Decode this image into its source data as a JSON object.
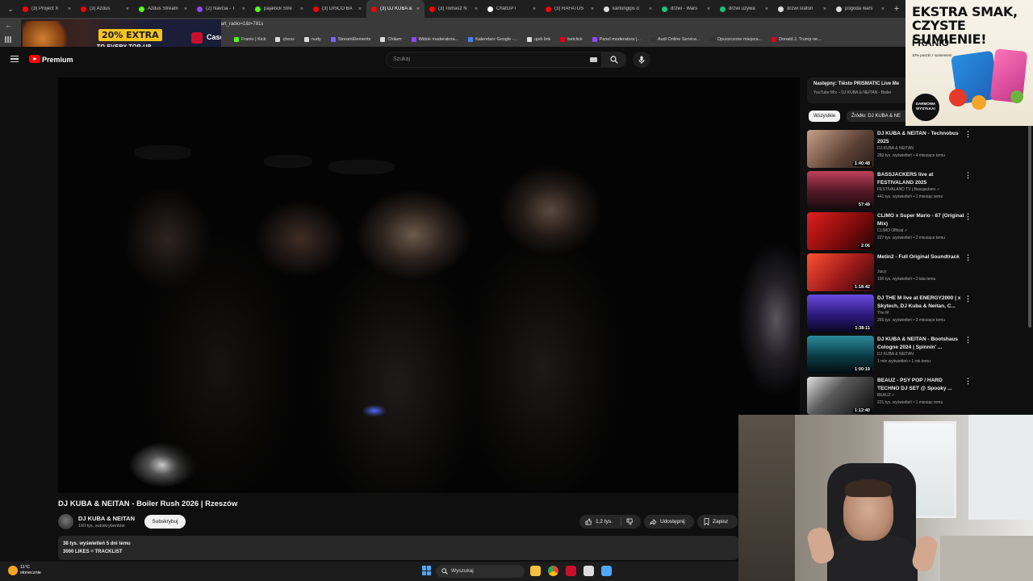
{
  "browser": {
    "tabs": [
      {
        "label": "(3) Project X",
        "color": "#ff0000"
      },
      {
        "label": "(3) Azdus",
        "color": "#ff0000"
      },
      {
        "label": "Azdus Stream",
        "color": "#53fc18"
      },
      {
        "label": "(2) Navcia - T",
        "color": "#9146ff"
      },
      {
        "label": "pajalock Stre",
        "color": "#53fc18"
      },
      {
        "label": "(3) DISCO BA",
        "color": "#ff0000"
      },
      {
        "label": "(3) DJ KUBA &",
        "color": "#ff0000",
        "active": true
      },
      {
        "label": "(3) Tomasz N",
        "color": "#ff0000"
      },
      {
        "label": "ChatGPT",
        "color": "#ffffff"
      },
      {
        "label": "(3) RAFATUS",
        "color": "#ff0000"
      },
      {
        "label": "kartongips d",
        "color": "#dddddd"
      },
      {
        "label": "drzwi - Wars",
        "color": "#19c37d"
      },
      {
        "label": "drzwi uzywa",
        "color": "#19c37d"
      },
      {
        "label": "drzwi srafon",
        "color": "#dddddd"
      },
      {
        "label": "pogoda wars",
        "color": "#dddddd"
      }
    ],
    "new_tab": "+",
    "url": "tart_radio=1&t=781s",
    "bookmarks": [
      {
        "label": "Franio | Kick",
        "color": "#53fc18"
      },
      {
        "label": "chess",
        "color": "#dddddd"
      },
      {
        "label": "nudy",
        "color": "#dddddd"
      },
      {
        "label": "StreamElements",
        "color": "#7b61ff"
      },
      {
        "label": "Chiłam",
        "color": "#dddddd"
      },
      {
        "label": "Widok moderatora...",
        "color": "#9146ff"
      },
      {
        "label": "Kalendarz Google -...",
        "color": "#4285f4"
      },
      {
        "label": "ujeb link",
        "color": "#dddddd"
      },
      {
        "label": "betclick",
        "color": "#e2001a"
      },
      {
        "label": "Panel moderatora |...",
        "color": "#9146ff"
      },
      {
        "label": "Audi Online Service...",
        "color": "#333333"
      },
      {
        "label": "Opuszczone miejsca...",
        "color": "#333333"
      },
      {
        "label": "Donald J. Trump ne...",
        "color": "#e2001a"
      }
    ]
  },
  "ad_left": {
    "badge": "20% EXTRA",
    "subtitle": "TO EVERY TOP-UP",
    "brand": "CaseHug"
  },
  "youtube": {
    "premium_label": "Premium",
    "search_placeholder": "Szukaj"
  },
  "video": {
    "title": "DJ KUBA & NEITAN - Boiler Rush 2026 | Rzeszów",
    "channel": "DJ KUBA & NEITAN",
    "subscribers": "100 tys. subskrybentów",
    "subscribe_label": "Subskrybuj",
    "likes": "1,2 tys.",
    "share_label": "Udostępnij",
    "save_label": "Zapisz",
    "desc_line1": "38 tys. wyświetleń  5 dni temu",
    "desc_line2": "3000 LIKES = TRACKLIST"
  },
  "sidebar": {
    "next_title": "Następny: Tiësto PRISMATIC Live Me",
    "next_sub": "YouTube Mix – DJ KUBA & NEITAN - Boiler",
    "chip_all": "Wszystkie",
    "chip_source": "Źródło: DJ KUBA & NE",
    "recs": [
      {
        "title": "DJ KUBA & NEITAN - Technobus 2025",
        "channel": "DJ KUBA & NEITAN",
        "meta": "280 tys. wyświetleń • 4 miesiące temu",
        "duration": "1:40:48",
        "thumb": "linear-gradient(135deg,#c8a08a,#5a4034 60%,#2a1e18)"
      },
      {
        "title": "BASSJACKERS live at FESTIVALAND 2025",
        "channel": "FESTIVALAND TV | Bassjackers ✓",
        "meta": "441 tys. wyświetleń • 1 miesiąc temu",
        "duration": "57:49",
        "thumb": "linear-gradient(180deg,#c0405a,#5a1a2a 50%,#1a0a10)"
      },
      {
        "title": "CLIMO x Super Mario - 67 (Original Mix)",
        "channel": "CLIMO Official ✓",
        "meta": "227 tys. wyświetleń • 2 miesiące temu",
        "duration": "2:06",
        "thumb": "linear-gradient(135deg,#e02020,#7a0a0a 60%,#200404)"
      },
      {
        "title": "Metin2 - Full Original Soundtrack",
        "channel": "Juicy",
        "meta": "156 tys. wyświetleń • 2 lata temu",
        "duration": "1:18:42",
        "thumb": "linear-gradient(135deg,#ff5030,#9a1a1a 55%,#300808)"
      },
      {
        "title": "DJ THE M live at ENERGY2000 | x Skytech, DJ Kuba & Neitan, C...",
        "channel": "The M",
        "meta": "265 tys. wyświetleń • 3 miesiące temu",
        "duration": "1:38:11",
        "thumb": "linear-gradient(180deg,#6a4ae0,#2a1a7a 55%,#0a0620)"
      },
      {
        "title": "DJ KUBA & NEITAN - Bootshaus Cologne 2024 | Spinnin' ...",
        "channel": "DJ KUBA & NEITAN",
        "meta": "1 mln wyświetleń • 1 rok temu",
        "duration": "1:00:19",
        "thumb": "linear-gradient(180deg,#2a8a9a,#0a3a44 55%,#020c10)"
      },
      {
        "title": "BEAUZ - PSY POP / HARD TECHNO DJ SET @ Spooky ...",
        "channel": "BEAUZ ✓",
        "meta": "221 tys. wyświetleń • 1 miesiąc temu",
        "duration": "1:12:40",
        "thumb": "linear-gradient(135deg,#e0e0e0,#5a5a5a 40%,#0a0a0a)"
      }
    ]
  },
  "ad_right": {
    "headline1": "EKSTRA SMAK,",
    "headline2": "CZYSTE SUMIENIE!",
    "brand": "FRANIO",
    "tagline": "10% puszki z sumieniem",
    "seal": "DARMOWA WYSYŁKA!"
  },
  "taskbar": {
    "temp": "11°C",
    "weather": "słonecznie",
    "search": "Wyszukaj"
  }
}
